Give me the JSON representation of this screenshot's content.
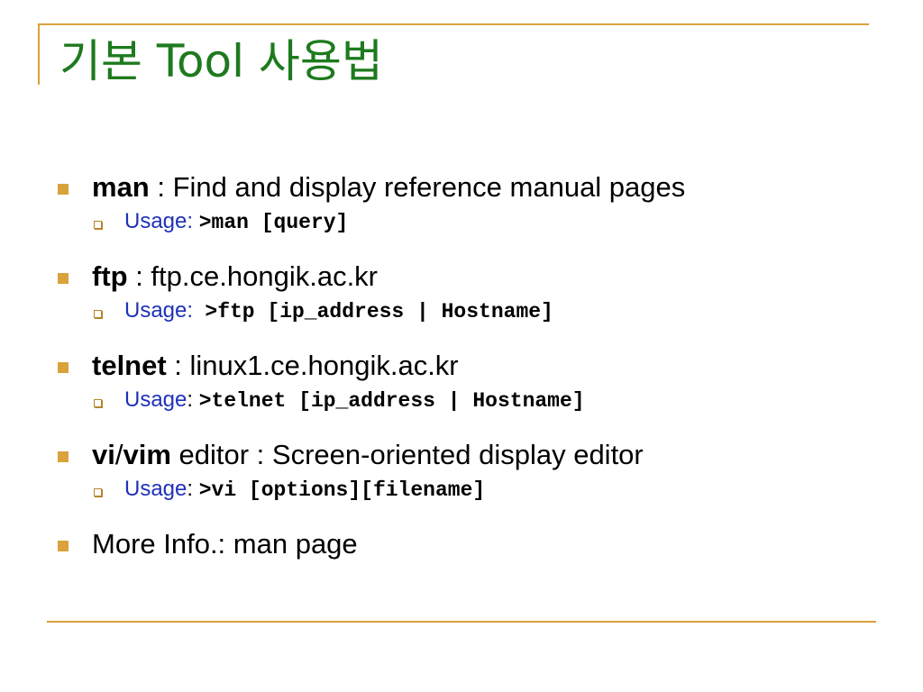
{
  "slide": {
    "title": "기본 Tool 사용법",
    "items": [
      {
        "term": "man",
        "rest": " :  Find and display reference manual pages",
        "usage_label": "Usage:",
        "usage_sep": " ",
        "usage_cmd": ">man [query]"
      },
      {
        "term": "ftp",
        "rest": " : ftp.ce.hongik.ac.kr",
        "usage_label": "Usage:",
        "usage_sep": "  ",
        "usage_cmd": ">ftp [ip_address | Hostname]"
      },
      {
        "term": "telnet",
        "rest": " : linux1.ce.hongik.ac.kr",
        "usage_label": "Usage",
        "usage_sep": ": ",
        "usage_cmd": ">telnet [ip_address | Hostname]"
      },
      {
        "term_a": "vi",
        "slash": "/",
        "term_b": "vim",
        "rest": " editor : Screen-oriented display editor",
        "usage_label": "Usage",
        "usage_sep": ": ",
        "usage_cmd": ">vi [options][filename]"
      }
    ],
    "more_info": "More Info.: man page"
  },
  "colors": {
    "title": "#1e7a1e",
    "accent_rule": "#d9a23a",
    "usage_label": "#1f32b8"
  }
}
